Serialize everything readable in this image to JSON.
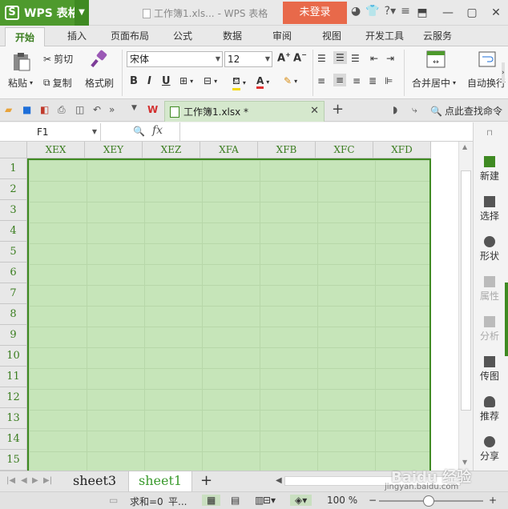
{
  "colors": {
    "brand": "#4e9a2d",
    "login": "#e8694a",
    "selection": "#c6e5b9",
    "header_text": "#3a7d1f"
  },
  "titlebar": {
    "app_name": "WPS 表格",
    "doc_title": "工作簿1.xls...",
    "app_suffix": "- WPS 表格",
    "login": "未登录"
  },
  "tabs": [
    "开始",
    "插入",
    "页面布局",
    "公式",
    "数据",
    "审阅",
    "视图",
    "开发工具",
    "云服务"
  ],
  "ribbon": {
    "paste": "粘贴",
    "cut": "剪切",
    "copy": "复制",
    "format_painter": "格式刷",
    "font_name": "宋体",
    "font_size": "12",
    "bold": "B",
    "italic": "I",
    "underline": "U",
    "font_color_label": "A",
    "merge_center": "合并居中",
    "auto_wrap": "自动换行"
  },
  "quickbar": {
    "doc_tab": "工作簿1.xlsx *",
    "find_command": "点此查找命令"
  },
  "formula_bar": {
    "cell_ref": "F1",
    "fx": "fx"
  },
  "grid": {
    "columns": [
      "XEX",
      "XEY",
      "XEZ",
      "XFA",
      "XFB",
      "XFC",
      "XFD"
    ],
    "rows": [
      "1",
      "2",
      "3",
      "4",
      "5",
      "6",
      "7",
      "8",
      "9",
      "10",
      "11",
      "12",
      "13",
      "14",
      "15"
    ]
  },
  "sidebar": {
    "items": [
      {
        "label": "新建",
        "icon": "new-icon",
        "disabled": false
      },
      {
        "label": "选择",
        "icon": "cursor-icon",
        "disabled": false
      },
      {
        "label": "形状",
        "icon": "shape-icon",
        "disabled": false
      },
      {
        "label": "属性",
        "icon": "properties-icon",
        "disabled": true
      },
      {
        "label": "分析",
        "icon": "analysis-icon",
        "disabled": true
      },
      {
        "label": "传图",
        "icon": "image-icon",
        "disabled": false
      },
      {
        "label": "推荐",
        "icon": "recommend-icon",
        "disabled": false
      },
      {
        "label": "分享",
        "icon": "share-icon",
        "disabled": false
      }
    ]
  },
  "sheets": [
    "sheet3",
    "sheet1"
  ],
  "active_sheet": "sheet1",
  "status": {
    "sum": "求和=0",
    "avg": "平...",
    "zoom": "100 %"
  },
  "watermark": {
    "text": "Baidu 经验",
    "url": "jingyan.baidu.com"
  }
}
